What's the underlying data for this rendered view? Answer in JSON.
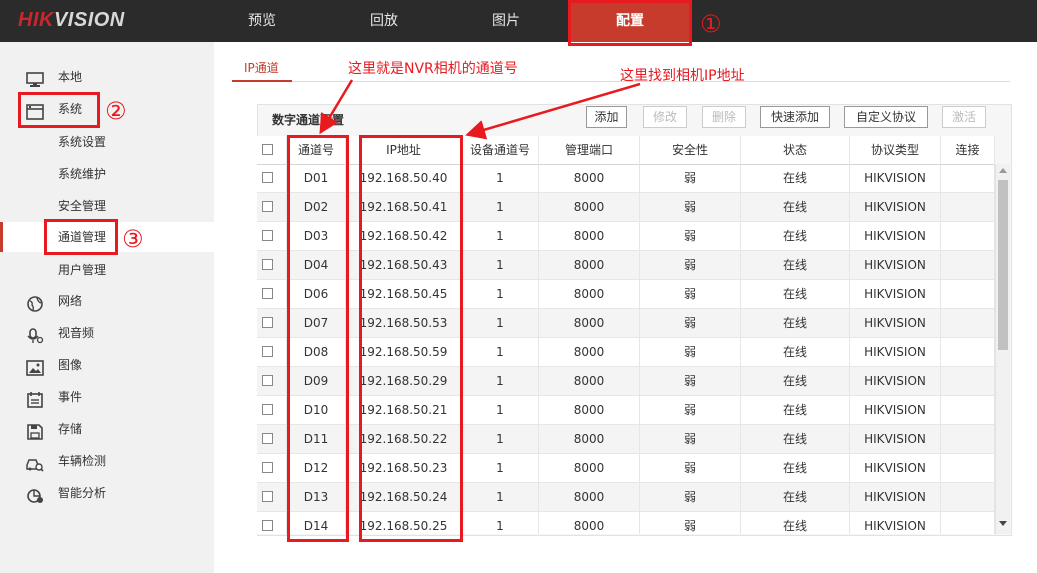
{
  "header": {
    "logo_text": "HIKVISION",
    "nav": [
      "预览",
      "回放",
      "图片",
      "配置"
    ],
    "active_nav": "配置"
  },
  "sidebar": {
    "items": [
      {
        "label": "本地",
        "icon": "monitor-icon"
      },
      {
        "label": "系统",
        "icon": "window-icon"
      },
      {
        "label": "网络",
        "icon": "globe-icon"
      },
      {
        "label": "视音频",
        "icon": "microphone-icon"
      },
      {
        "label": "图像",
        "icon": "image-icon"
      },
      {
        "label": "事件",
        "icon": "calendar-icon"
      },
      {
        "label": "存储",
        "icon": "floppy-icon"
      },
      {
        "label": "车辆检测",
        "icon": "car-search-icon"
      },
      {
        "label": "智能分析",
        "icon": "analytics-icon"
      }
    ],
    "system_sub": [
      "系统设置",
      "系统维护",
      "安全管理",
      "通道管理",
      "用户管理"
    ],
    "active_sub": "通道管理"
  },
  "tabs": [
    "IP通道"
  ],
  "panel": {
    "title": "数字通道配置",
    "buttons": [
      {
        "label": "添加",
        "enabled": true
      },
      {
        "label": "修改",
        "enabled": false
      },
      {
        "label": "删除",
        "enabled": false
      },
      {
        "label": "快速添加",
        "enabled": true
      },
      {
        "label": "自定义协议",
        "enabled": true
      },
      {
        "label": "激活",
        "enabled": false
      }
    ]
  },
  "table": {
    "columns": [
      "通道号",
      "IP地址",
      "设备通道号",
      "管理端口",
      "安全性",
      "状态",
      "协议类型",
      "连接"
    ],
    "rows": [
      [
        "D01",
        "192.168.50.40",
        "1",
        "8000",
        "弱",
        "在线",
        "HIKVISION",
        ""
      ],
      [
        "D02",
        "192.168.50.41",
        "1",
        "8000",
        "弱",
        "在线",
        "HIKVISION",
        ""
      ],
      [
        "D03",
        "192.168.50.42",
        "1",
        "8000",
        "弱",
        "在线",
        "HIKVISION",
        ""
      ],
      [
        "D04",
        "192.168.50.43",
        "1",
        "8000",
        "弱",
        "在线",
        "HIKVISION",
        ""
      ],
      [
        "D06",
        "192.168.50.45",
        "1",
        "8000",
        "弱",
        "在线",
        "HIKVISION",
        ""
      ],
      [
        "D07",
        "192.168.50.53",
        "1",
        "8000",
        "弱",
        "在线",
        "HIKVISION",
        ""
      ],
      [
        "D08",
        "192.168.50.59",
        "1",
        "8000",
        "弱",
        "在线",
        "HIKVISION",
        ""
      ],
      [
        "D09",
        "192.168.50.29",
        "1",
        "8000",
        "弱",
        "在线",
        "HIKVISION",
        ""
      ],
      [
        "D10",
        "192.168.50.21",
        "1",
        "8000",
        "弱",
        "在线",
        "HIKVISION",
        ""
      ],
      [
        "D11",
        "192.168.50.22",
        "1",
        "8000",
        "弱",
        "在线",
        "HIKVISION",
        ""
      ],
      [
        "D12",
        "192.168.50.23",
        "1",
        "8000",
        "弱",
        "在线",
        "HIKVISION",
        ""
      ],
      [
        "D13",
        "192.168.50.24",
        "1",
        "8000",
        "弱",
        "在线",
        "HIKVISION",
        ""
      ],
      [
        "D14",
        "192.168.50.25",
        "1",
        "8000",
        "弱",
        "在线",
        "HIKVISION",
        ""
      ]
    ]
  },
  "annotations": {
    "nvr_channel_note": "这里就是NVR相机的通道号",
    "camera_ip_note": "这里找到相机IP地址",
    "marker_1": "①",
    "marker_2": "②",
    "marker_3": "③"
  },
  "colors": {
    "accent": "#c63b2b",
    "annotation_red": "#e8191f",
    "topbar": "#2b2b2b"
  }
}
